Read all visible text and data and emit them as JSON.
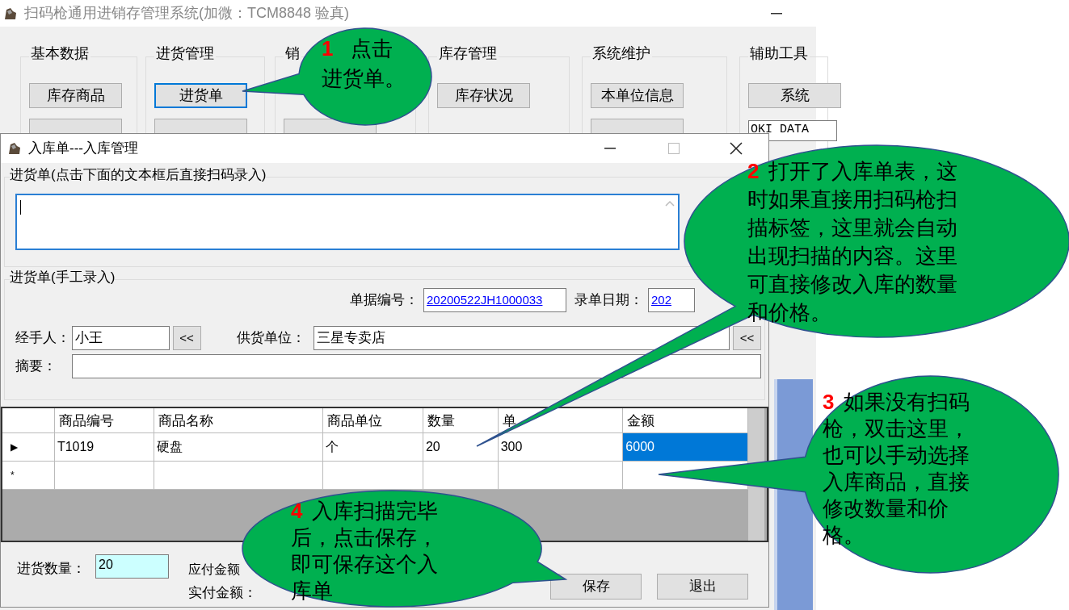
{
  "main_window": {
    "title": "扫码枪通用进销存管理系统(加微：TCM8848 验真)",
    "groups": [
      {
        "title": "基本数据",
        "top": {
          "label": "库存商品",
          "focused": false
        },
        "bottom": {
          "kind": "button"
        }
      },
      {
        "title": "进货管理",
        "top": {
          "label": "进货单",
          "focused": true
        },
        "bottom": {
          "kind": "button"
        }
      },
      {
        "title": "销",
        "bottom": {
          "kind": "button"
        }
      },
      {
        "title": "库存管理",
        "top": {
          "label": "库存状况",
          "focused": false
        }
      },
      {
        "title": "系统维护",
        "top": {
          "label": "本单位信息",
          "focused": false
        },
        "bottom": {
          "kind": "button"
        }
      },
      {
        "title": "辅助工具",
        "top": {
          "label": "系统",
          "focused": false
        },
        "bottom": {
          "kind": "combo",
          "label": "OKI DATA"
        }
      }
    ]
  },
  "dialog": {
    "title": "入库单---入库管理",
    "scan_group": {
      "legend": "进货单(点击下面的文本框后直接扫码录入)"
    },
    "manual_group": {
      "legend": "进货单(手工录入)",
      "fields": [
        {
          "label": "单据编号：",
          "value": "20200522JH1000033"
        },
        {
          "label": "录单日期：",
          "value": "202"
        },
        {
          "label": "经手人：",
          "value": "小王",
          "button": "<<"
        },
        {
          "label": "供货单位：",
          "value": "三星专卖店",
          "button": "<<"
        },
        {
          "label": "摘要："
        }
      ]
    },
    "table": {
      "columns": [
        "商品编号",
        "商品名称",
        "商品单位",
        "数量",
        "单",
        "金额"
      ],
      "rows": [
        {
          "marker": "▶",
          "cells": [
            {
              "text": "T1019",
              "selected": false
            },
            {
              "text": "硬盘",
              "selected": false
            },
            {
              "text": "个",
              "selected": false
            },
            {
              "text": "20",
              "selected": false
            },
            {
              "text": "300",
              "selected": false
            },
            {
              "text": "6000",
              "selected": true
            }
          ]
        },
        {
          "marker": "*",
          "cells": [
            {
              "selected": false
            },
            {
              "selected": false
            },
            {
              "selected": false
            },
            {
              "selected": false
            },
            {
              "selected": false
            },
            {
              "selected": false
            }
          ]
        }
      ]
    },
    "footer": {
      "qty_label": "进货数量：",
      "qty_value": "20",
      "payable_label": "应付金额",
      "paid_label": "实付金额：",
      "buttons": [
        "保存",
        "退出"
      ]
    }
  },
  "callouts": [
    {
      "number": "1",
      "text": "点击进货单。"
    },
    {
      "number": "2",
      "text": "打开了入库单表，这时如果直接用扫码枪扫描标签，这里就会自动出现扫描的内容。这里可直接修改入库的数量和价格。"
    },
    {
      "number": "3",
      "text": "如果没有扫码枪，双击这里，也可以手动选择入库商品，直接修改数量和价格。"
    },
    {
      "number": "4",
      "text": "入库扫描完毕后，点击保存，即可保存这个入库单"
    }
  ]
}
